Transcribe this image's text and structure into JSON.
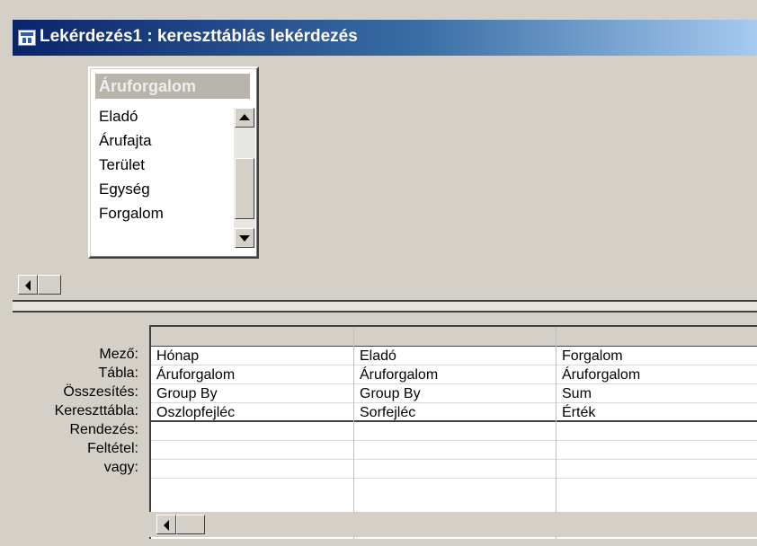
{
  "window": {
    "title": "Lekérdezés1 : kereszttáblás lekérdezés",
    "icon": "query-design-icon"
  },
  "field_list": {
    "table_name": "Áruforgalom",
    "fields": [
      "Eladó",
      "Árufajta",
      "Terület",
      "Egység",
      "Forgalom"
    ]
  },
  "grid": {
    "row_labels": [
      "Mező:",
      "Tábla:",
      "Összesítés:",
      "Kereszttábla:",
      "Rendezés:",
      "Feltétel:",
      "vagy:"
    ],
    "columns": [
      {
        "field": "Hónap",
        "table": "Áruforgalom",
        "total": "Group By",
        "crosstab": "Oszlopfejléc",
        "sort": "",
        "criteria": "",
        "or": ""
      },
      {
        "field": "Eladó",
        "table": "Áruforgalom",
        "total": "Group By",
        "crosstab": "Sorfejléc",
        "sort": "",
        "criteria": "",
        "or": ""
      },
      {
        "field": "Forgalom",
        "table": "Áruforgalom",
        "total": "Sum",
        "crosstab": "Érték",
        "sort": "",
        "criteria": "",
        "or": ""
      }
    ]
  },
  "colors": {
    "title_start": "#0a246a",
    "title_end": "#a6caf0",
    "face": "#d4d0c8"
  }
}
